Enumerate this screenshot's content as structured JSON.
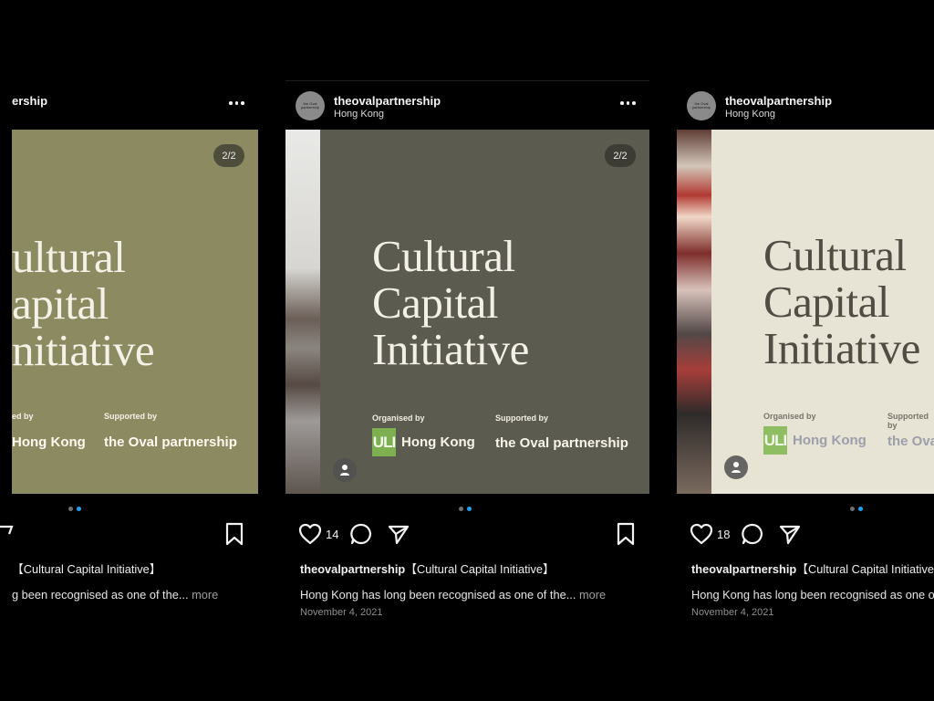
{
  "common": {
    "avatar_text": "the Oval partnership",
    "organised_by": "Organised by",
    "supported_by": "Supported by",
    "uli_badge": "ULI",
    "uli_location": "Hong Kong",
    "oval_name": "the Oval partnership",
    "title_lines": [
      "Cultural",
      "Capital",
      "Initiative"
    ],
    "more_text": "more"
  },
  "posts": [
    {
      "username_fragment": "ership",
      "counter": "2/2",
      "title_visible": [
        "ultural",
        "apital",
        "nitiative"
      ],
      "organised_fragment": "ed by",
      "uli_fragment": "Hong Kong",
      "caption_fragment": "【Cultural Capital Initiative】",
      "body_fragment": "g been recognised as one of the...",
      "body_more": "more",
      "colors": {
        "panel": "#8b8a61"
      }
    },
    {
      "username": "theovalpartnership",
      "location": "Hong Kong",
      "counter": "2/2",
      "likes": "14",
      "caption_title": "【Cultural Capital Initiative】",
      "body": "Hong Kong has long been recognised as one of the...",
      "body_more": "more",
      "date": "November 4, 2021",
      "colors": {
        "panel": "#5c5b4f"
      }
    },
    {
      "username": "theovalpartnership",
      "location": "Hong Kong",
      "likes": "18",
      "caption_title": "【Cultural Capital Initiative】",
      "body_fragment": "Hong Kong has long been recognised as one o",
      "date": "November 4, 2021",
      "oval_fragment": "the Oval",
      "colors": {
        "panel": "#e8e4d5",
        "title": "#514c44"
      }
    }
  ]
}
